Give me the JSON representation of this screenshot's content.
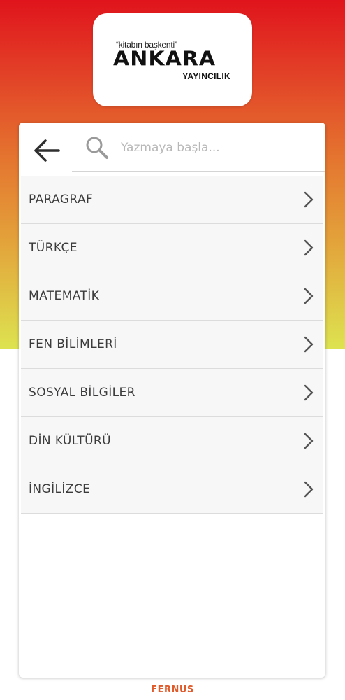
{
  "logo": {
    "tagline": "“kitabın başkenti”",
    "wordmark": "ANKARA",
    "subtitle": "YAYINCILIK"
  },
  "search": {
    "placeholder": "Yazmaya başla..."
  },
  "categories": [
    {
      "label": "PARAGRAF"
    },
    {
      "label": "TÜRKÇE"
    },
    {
      "label": "MATEMATİK"
    },
    {
      "label": "FEN BİLİMLERİ"
    },
    {
      "label": "SOSYAL BİLGİLER"
    },
    {
      "label": "DİN KÜLTÜRÜ"
    },
    {
      "label": "İNGİLİZCE"
    }
  ],
  "footer": {
    "brand": "FERNUS"
  },
  "colors": {
    "gradient_top": "#e0141c",
    "gradient_bottom": "#dde350",
    "footer_brand": "#e05a2a",
    "icon": "#3a3a3a"
  }
}
